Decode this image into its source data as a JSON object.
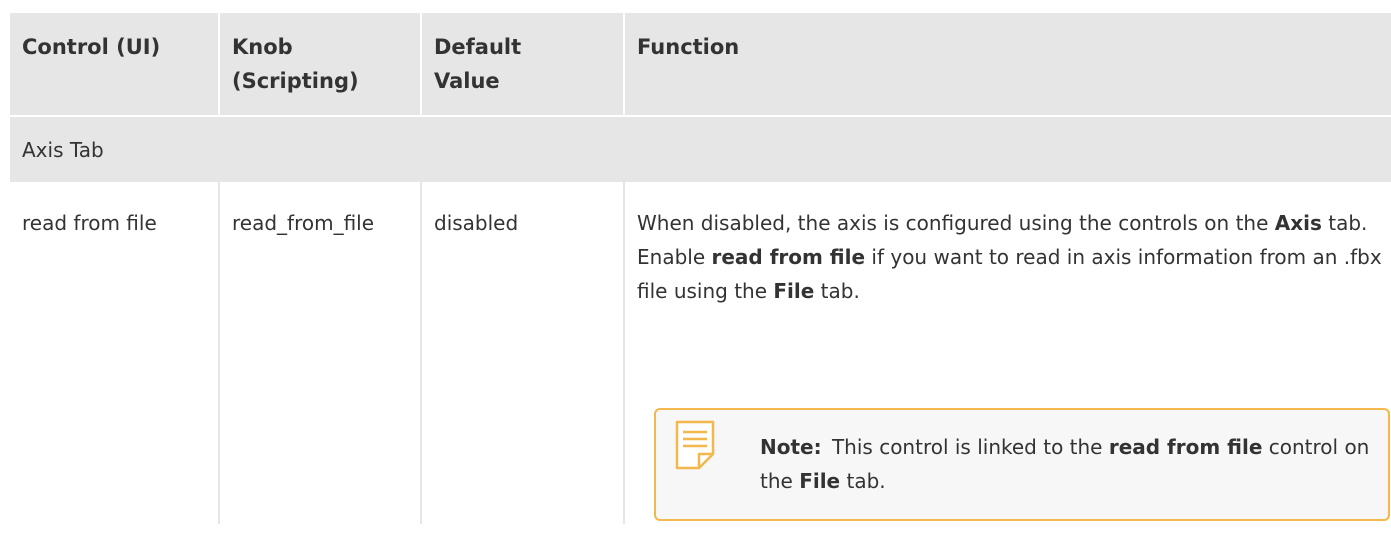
{
  "table": {
    "headers": {
      "control": "Control (UI)",
      "knob_line1": "Knob",
      "knob_line2": "(Scripting)",
      "default_line1": "Default",
      "default_line2": "Value",
      "function": "Function"
    },
    "section": "Axis Tab",
    "row": {
      "control": "read from file",
      "knob": "read_from_file",
      "default": "disabled",
      "function": {
        "t1": "When disabled, the axis is configured using the controls on the ",
        "b1": "Axis",
        "t2": " tab. Enable ",
        "b2": "read from file",
        "t3": " if you want to read in axis information from an .fbx file using the ",
        "b3": "File",
        "t4": " tab."
      }
    }
  },
  "note": {
    "icon": "note-icon",
    "label": "Note:",
    "t1": "This control is linked to the ",
    "b1": "read from file",
    "t2": " control on the ",
    "b2": "File",
    "t3": " tab.",
    "border_color": "#f2b84b"
  }
}
